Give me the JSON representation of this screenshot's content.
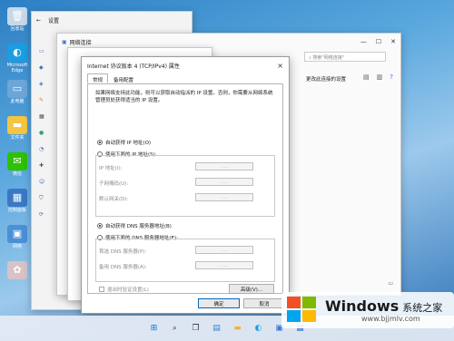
{
  "desktop": {
    "icons": [
      {
        "label": "回收站",
        "glyph": "🗑",
        "color": "#c8d8e8"
      },
      {
        "label": "Microsoft Edge",
        "glyph": "◐",
        "color": "#1b9de2"
      },
      {
        "label": "此电脑",
        "glyph": "▭",
        "color": "#6aa6d8"
      },
      {
        "label": "文件夹",
        "glyph": "▬",
        "color": "#f5c542"
      },
      {
        "label": "微信",
        "glyph": "✉",
        "color": "#2dc100"
      },
      {
        "label": "控制面板",
        "glyph": "▦",
        "color": "#3b78c4"
      },
      {
        "label": "网络",
        "glyph": "▣",
        "color": "#4a90d9"
      },
      {
        "label": "",
        "glyph": "✿",
        "color": "#d8c2c8"
      }
    ]
  },
  "settings_window": {
    "title": "设置"
  },
  "network_window": {
    "title": "网络连接",
    "search_placeholder": "搜索\"网络连接\"",
    "change_text": "更改此连接的设置"
  },
  "dialog": {
    "title": "Internet 协议版本 4 (TCP/IPv4) 属性",
    "close_icon": "×",
    "tabs": [
      "常规",
      "备用配置"
    ],
    "description": "如果网络支持此功能，则可以获取自动指派的 IP 设置。否则，你需要从网络系统管理员处获得适当的 IP 设置。",
    "auto_ip": "自动获得 IP 地址(O)",
    "manual_ip": "使用下面的 IP 地址(S):",
    "ip_label": "IP 地址(I):",
    "mask_label": "子网掩码(U):",
    "gateway_label": "默认网关(D):",
    "auto_dns": "自动获得 DNS 服务器地址(B)",
    "manual_dns": "使用下面的 DNS 服务器地址(E):",
    "dns1_label": "首选 DNS 服务器(P):",
    "dns2_label": "备用 DNS 服务器(A):",
    "validate_label": "退出时验证设置(L)",
    "advanced_label": "高级(V)...",
    "ok_label": "确定",
    "cancel_label": "取消",
    "ip_dots": ". . ."
  },
  "taskbar": {
    "apps": [
      {
        "name": "start",
        "glyph": "⊞",
        "color": "#0078d4"
      },
      {
        "name": "search",
        "glyph": "⌕",
        "color": "#333333"
      },
      {
        "name": "taskview",
        "glyph": "❐",
        "color": "#333333"
      },
      {
        "name": "widgets",
        "glyph": "▤",
        "color": "#2b88d8"
      },
      {
        "name": "explorer",
        "glyph": "▬",
        "color": "#f2b632"
      },
      {
        "name": "edge",
        "glyph": "◐",
        "color": "#1b9de2"
      },
      {
        "name": "store",
        "glyph": "▣",
        "color": "#3a7bd5"
      },
      {
        "name": "network",
        "glyph": "▦",
        "color": "#3b78c4"
      }
    ]
  },
  "watermark": {
    "brand": "Windows",
    "slogan": "系统之家",
    "url": "www.bjjmlv.com"
  }
}
